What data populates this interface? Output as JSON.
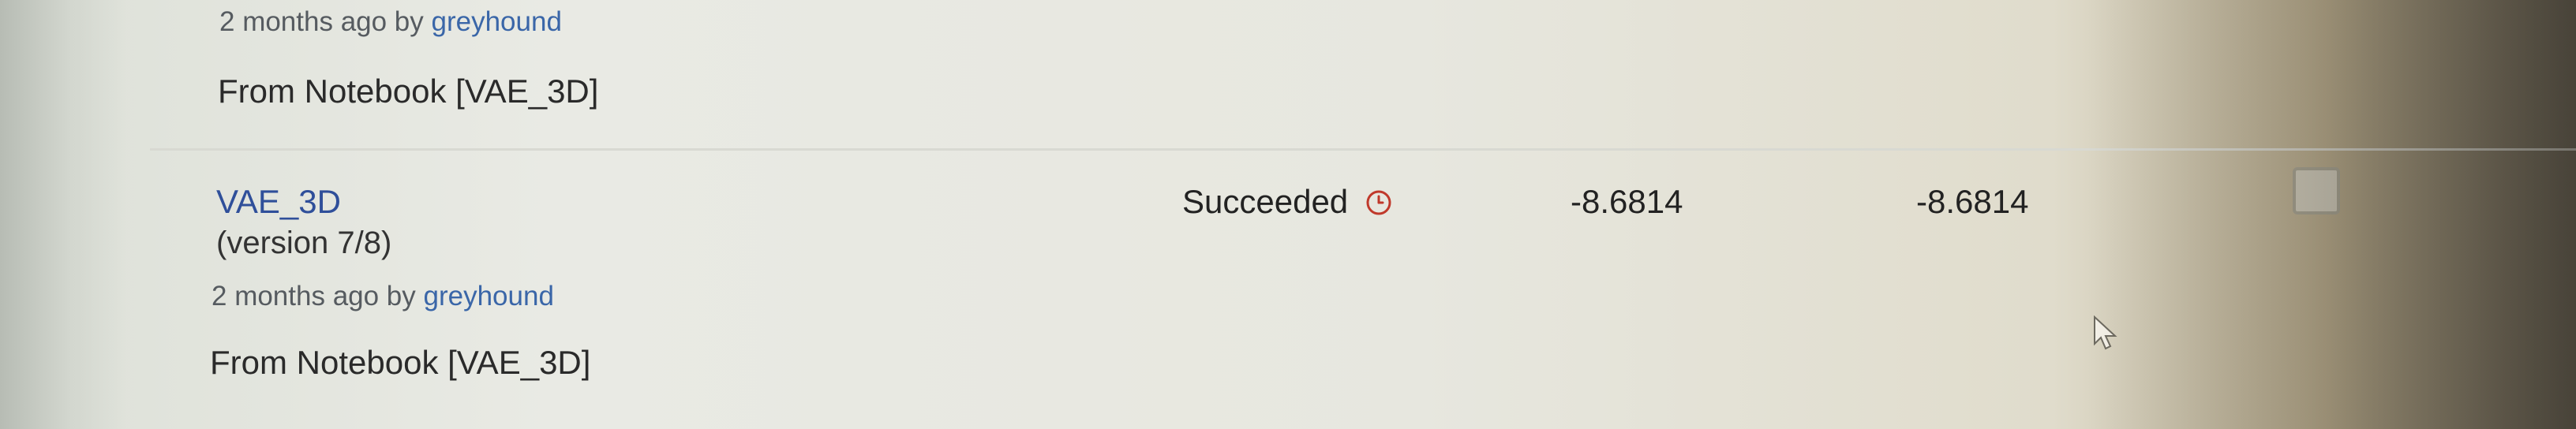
{
  "rows": [
    {
      "meta_prefix": "2 months ago by ",
      "meta_user": "greyhound",
      "source": "From Notebook [VAE_3D]"
    },
    {
      "title": "VAE_3D",
      "version": "(version 7/8)",
      "status": "Succeeded",
      "status_icon": "clock-icon",
      "public_score": "-8.6814",
      "private_score": "-8.6814",
      "meta_prefix": "2 months ago by ",
      "meta_user": "greyhound",
      "source": "From Notebook [VAE_3D]"
    }
  ],
  "colors": {
    "link": "#2f4f9a",
    "user": "#3a66a8",
    "status_icon": "#c0392b"
  }
}
